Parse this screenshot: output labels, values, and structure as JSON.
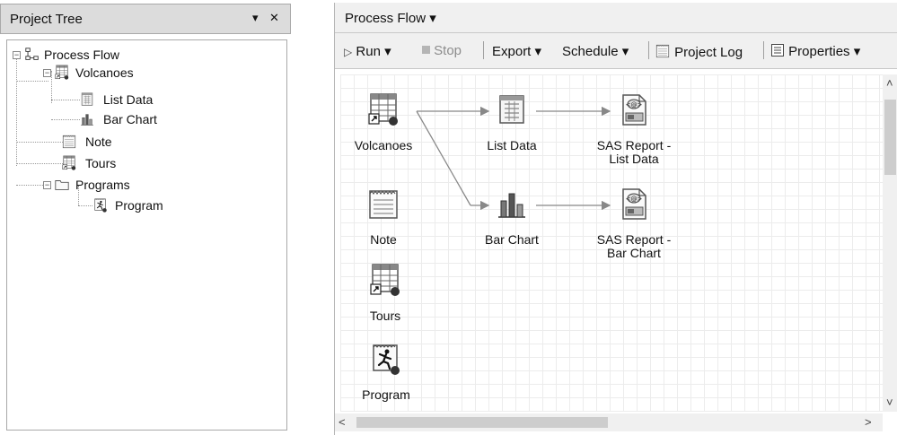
{
  "project_tree": {
    "title": "Project Tree",
    "dropdown_glyph": "▾",
    "close_glyph": "✕",
    "nodes": [
      {
        "label": "Process Flow",
        "icon": "process-flow-icon"
      },
      {
        "label": "Volcanoes",
        "icon": "data-table-icon"
      },
      {
        "label": "List Data",
        "icon": "list-data-icon"
      },
      {
        "label": "Bar Chart",
        "icon": "bar-chart-icon"
      },
      {
        "label": "Note",
        "icon": "note-icon"
      },
      {
        "label": "Tours",
        "icon": "data-table-icon"
      },
      {
        "label": "Programs",
        "icon": "folder-icon"
      },
      {
        "label": "Program",
        "icon": "program-icon"
      }
    ]
  },
  "process_flow": {
    "title": "Process Flow ▾",
    "toolbar": {
      "run": "Run ▾",
      "stop": "Stop",
      "export": "Export ▾",
      "schedule": "Schedule ▾",
      "project_log": "Project Log",
      "properties": "Properties ▾"
    },
    "nodes": {
      "volcanoes": "Volcanoes",
      "list_data": "List Data",
      "report_list_line1": "SAS Report -",
      "report_list_line2": "List Data",
      "note": "Note",
      "bar_chart": "Bar Chart",
      "report_bar_line1": "SAS Report -",
      "report_bar_line2": "Bar Chart",
      "tours": "Tours",
      "program": "Program"
    }
  },
  "colors": {
    "panel_header": "#dcdcdc",
    "toolbar": "#f0f0f0",
    "grid": "#ececec",
    "border": "#a9a9a9"
  }
}
